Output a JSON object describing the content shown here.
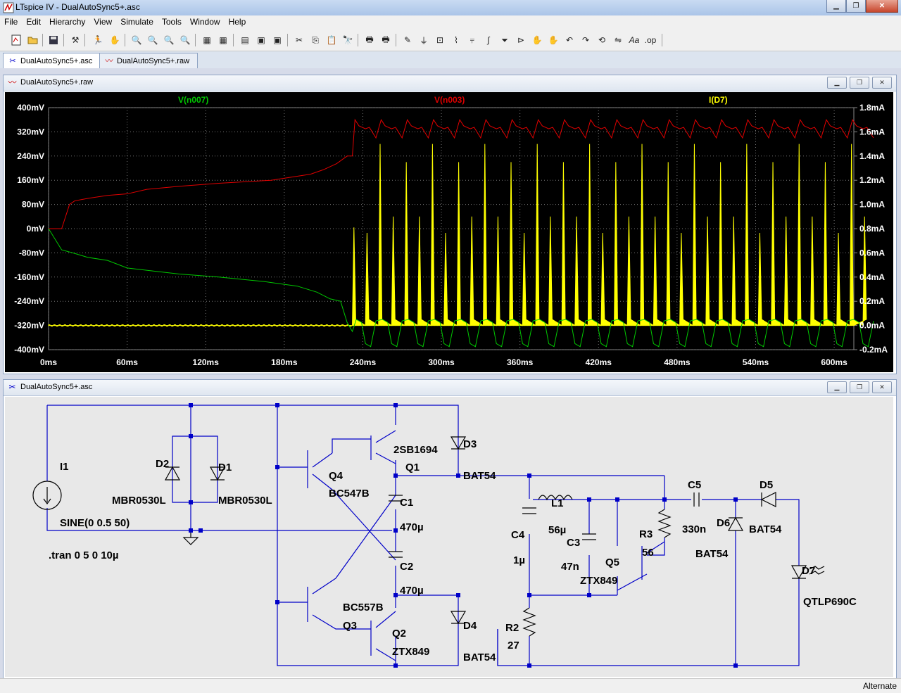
{
  "window": {
    "title": "LTspice IV - DualAutoSync5+.asc"
  },
  "menu": [
    "File",
    "Edit",
    "Hierarchy",
    "View",
    "Simulate",
    "Tools",
    "Window",
    "Help"
  ],
  "tabs": [
    {
      "label": "DualAutoSync5+.asc",
      "icon": "schematic-icon",
      "active": true
    },
    {
      "label": "DualAutoSync5+.raw",
      "icon": "waveform-icon",
      "active": false
    }
  ],
  "waveform_window": {
    "title": "DualAutoSync5+.raw"
  },
  "schematic_window": {
    "title": "DualAutoSync5+.asc"
  },
  "status": {
    "mode": "Alternate"
  },
  "colors": {
    "vn007": "#00c800",
    "vn003": "#e00000",
    "id7": "#ffff00",
    "wire": "#0000c8",
    "background_plot": "#000000"
  },
  "chart_data": {
    "type": "line",
    "series": [
      {
        "name": "V(n007)",
        "axis": "left",
        "color": "#00c800"
      },
      {
        "name": "V(n003)",
        "axis": "left",
        "color": "#e00000"
      },
      {
        "name": "I(D7)",
        "axis": "right",
        "color": "#ffff00"
      }
    ],
    "xlim": [
      0,
      615
    ],
    "x_ticks": [
      "0ms",
      "60ms",
      "120ms",
      "180ms",
      "240ms",
      "300ms",
      "360ms",
      "420ms",
      "480ms",
      "540ms",
      "600ms"
    ],
    "left_ylim": [
      -400,
      400
    ],
    "left_ticks": [
      "400mV",
      "320mV",
      "240mV",
      "160mV",
      "80mV",
      "0mV",
      "-80mV",
      "-160mV",
      "-240mV",
      "-320mV",
      "-400mV"
    ],
    "right_ylim": [
      -0.2,
      1.8
    ],
    "right_ticks": [
      "1.8mA",
      "1.6mA",
      "1.4mA",
      "1.2mA",
      "1.0mA",
      "0.8mA",
      "0.6mA",
      "0.4mA",
      "0.2mA",
      "0.0mA",
      "-0.2mA"
    ],
    "grid": true,
    "vn003_steps": [
      [
        0,
        0
      ],
      [
        10,
        0
      ],
      [
        16,
        80
      ],
      [
        20,
        92
      ],
      [
        30,
        100
      ],
      [
        45,
        110
      ],
      [
        60,
        115
      ],
      [
        75,
        130
      ],
      [
        100,
        140
      ],
      [
        130,
        150
      ],
      [
        170,
        160
      ],
      [
        200,
        180
      ],
      [
        210,
        195
      ],
      [
        220,
        215
      ],
      [
        228,
        240
      ],
      [
        232,
        240
      ]
    ],
    "vn007_steps": [
      [
        0,
        0
      ],
      [
        10,
        -70
      ],
      [
        20,
        -82
      ],
      [
        30,
        -95
      ],
      [
        45,
        -105
      ],
      [
        60,
        -130
      ],
      [
        80,
        -140
      ],
      [
        100,
        -150
      ],
      [
        130,
        -160
      ],
      [
        165,
        -175
      ],
      [
        190,
        -190
      ],
      [
        205,
        -210
      ],
      [
        215,
        -232
      ],
      [
        223,
        -240
      ],
      [
        228,
        -310
      ],
      [
        232,
        -340
      ]
    ],
    "oscillation": {
      "start_ms": 232,
      "period_ms": 20,
      "vn003_peak_mV": 360,
      "vn003_trough_mV": 300,
      "vn007_high_mV": -300,
      "vn007_low_mV": -390,
      "id7_peak_mA": [
        1.35,
        1.5
      ],
      "id7_mid_peak_mA": 0.9,
      "id7_baseline_mA": 0.0
    }
  },
  "schematic": {
    "labels": [
      {
        "id": "I1",
        "text": "I1"
      },
      {
        "id": "I1v",
        "text": "SINE(0 0.5 50)"
      },
      {
        "id": "tran",
        "text": ".tran 0 5 0 10µ"
      },
      {
        "id": "D2",
        "text": "D2"
      },
      {
        "id": "D2v",
        "text": "MBR0530L"
      },
      {
        "id": "D1",
        "text": "D1"
      },
      {
        "id": "D1v",
        "text": "MBR0530L"
      },
      {
        "id": "Q4",
        "text": "Q4"
      },
      {
        "id": "Q4v",
        "text": "BC547B"
      },
      {
        "id": "Q1v",
        "text": "2SB1694"
      },
      {
        "id": "Q1",
        "text": "Q1"
      },
      {
        "id": "D3",
        "text": "D3"
      },
      {
        "id": "D3v",
        "text": "BAT54"
      },
      {
        "id": "C1",
        "text": "C1"
      },
      {
        "id": "C1v",
        "text": "470µ"
      },
      {
        "id": "C2",
        "text": "C2"
      },
      {
        "id": "C2v",
        "text": "470µ"
      },
      {
        "id": "Q3v",
        "text": "BC557B"
      },
      {
        "id": "Q3",
        "text": "Q3"
      },
      {
        "id": "Q2",
        "text": "Q2"
      },
      {
        "id": "Q2v",
        "text": "ZTX849"
      },
      {
        "id": "D4",
        "text": "D4"
      },
      {
        "id": "D4v",
        "text": "BAT54"
      },
      {
        "id": "L1",
        "text": "L1"
      },
      {
        "id": "L1v",
        "text": "56µ"
      },
      {
        "id": "C4",
        "text": "C4"
      },
      {
        "id": "C4v",
        "text": "1µ"
      },
      {
        "id": "C3",
        "text": "C3"
      },
      {
        "id": "C3v",
        "text": "47n"
      },
      {
        "id": "Q5",
        "text": "Q5"
      },
      {
        "id": "Q5v",
        "text": "ZTX849"
      },
      {
        "id": "R3",
        "text": "R3"
      },
      {
        "id": "R3v",
        "text": "56"
      },
      {
        "id": "R2",
        "text": "R2"
      },
      {
        "id": "R2v",
        "text": "27"
      },
      {
        "id": "C5",
        "text": "C5"
      },
      {
        "id": "C5v",
        "text": "330n"
      },
      {
        "id": "D5",
        "text": "D5"
      },
      {
        "id": "D5v",
        "text": "BAT54"
      },
      {
        "id": "D6",
        "text": "D6"
      },
      {
        "id": "D6v",
        "text": "BAT54"
      },
      {
        "id": "D7",
        "text": "D7"
      },
      {
        "id": "D7v",
        "text": "QTLP690C"
      }
    ]
  }
}
